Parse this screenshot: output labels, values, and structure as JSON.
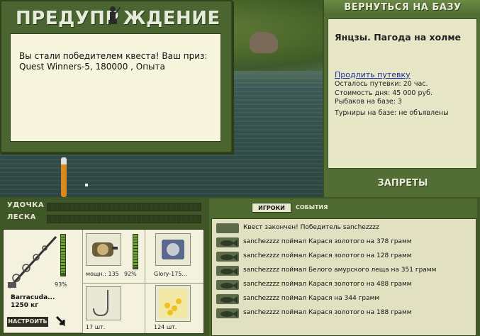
{
  "warning": {
    "title": "ПРЕДУПР ЖДЕНИЕ",
    "message_line1": "Вы стали победителем квеста! Ваш приз:",
    "message_line2": "Quest Winners-5, 180000 , Опыта"
  },
  "base_panel": {
    "back_button": "ВЕРНУТЬСЯ НА БАЗУ",
    "base_name": "Янцзы. Пагода на холме",
    "extend_link": "Продлить путевку",
    "time_left": "Осталось путевки: 20 час.",
    "day_cost": "Стоимость дня: 45 000 руб.",
    "fishers": "Рыбаков на базе: 3",
    "tournaments": "Турниры на базе: не объявлены",
    "bans_button": "ЗАПРЕТЫ"
  },
  "gauges": {
    "rod_label": "УДОЧКА",
    "line_label": "ЛЕСКА",
    "rod_level": 0,
    "line_level": 0
  },
  "tackle": {
    "rod": {
      "name_line1": "Barracuda...",
      "name_line2": "1250 кг",
      "condition": "93%",
      "condition_level": 0.93
    },
    "setup_button": "НАСТРОИТЬ",
    "reel": {
      "caption": "мощн.: 135",
      "condition": "92%",
      "condition_level": 0.92
    },
    "line": {
      "caption": "Glory-175..."
    },
    "hook": {
      "caption": "17 шт."
    },
    "bait": {
      "caption": "124 шт."
    }
  },
  "chat": {
    "tab_players": "ИГРОКИ",
    "tab_events": "СОБЫТИЯ",
    "entries": [
      "Квест закончен! Победитель sanchezzzz",
      "sanchezzzz поймал Карася золотого на 378 грамм",
      "sanchezzzz поймал Карася золотого на 128 грамм",
      "sanchezzzz поймал Белого амурского леща на 351 грамм",
      "sanchezzzz поймал Карася золотого на 488 грамм",
      "sanchezzzz поймал Карася на 344 грамм",
      "sanchezzzz поймал Карася золотого на 188 грамм"
    ]
  },
  "colors": {
    "panel": "#4e6a31",
    "paper": "#f7f5dd",
    "link": "#1a2ea0"
  }
}
